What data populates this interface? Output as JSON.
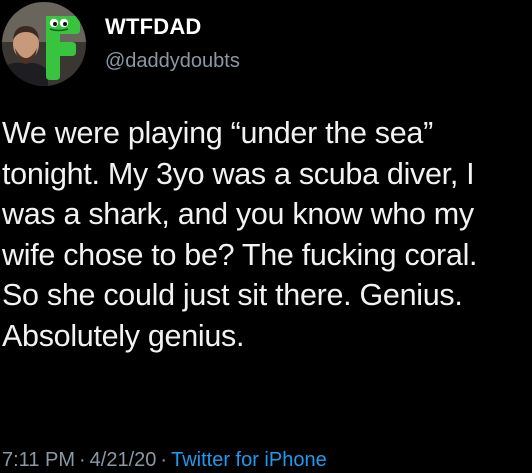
{
  "user": {
    "display_name": "WTFDAD",
    "handle": "@daddydoubts"
  },
  "tweet": {
    "lines": [
      "We were playing “under the sea”",
      "tonight. My 3yo was a scuba diver, I",
      "was a shark, and you know who my",
      "wife chose to be? The fucking coral.",
      "So she could just sit there. Genius.",
      "Absolutely genius."
    ]
  },
  "meta": {
    "time": "7:11 PM",
    "separator": "·",
    "date": "4/21/20",
    "source": "Twitter for iPhone"
  },
  "colors": {
    "background": "#000000",
    "text": "#f2f2f2",
    "secondary": "#8b98a5",
    "link": "#1d9bf0",
    "logo_green": "#39c43f"
  }
}
